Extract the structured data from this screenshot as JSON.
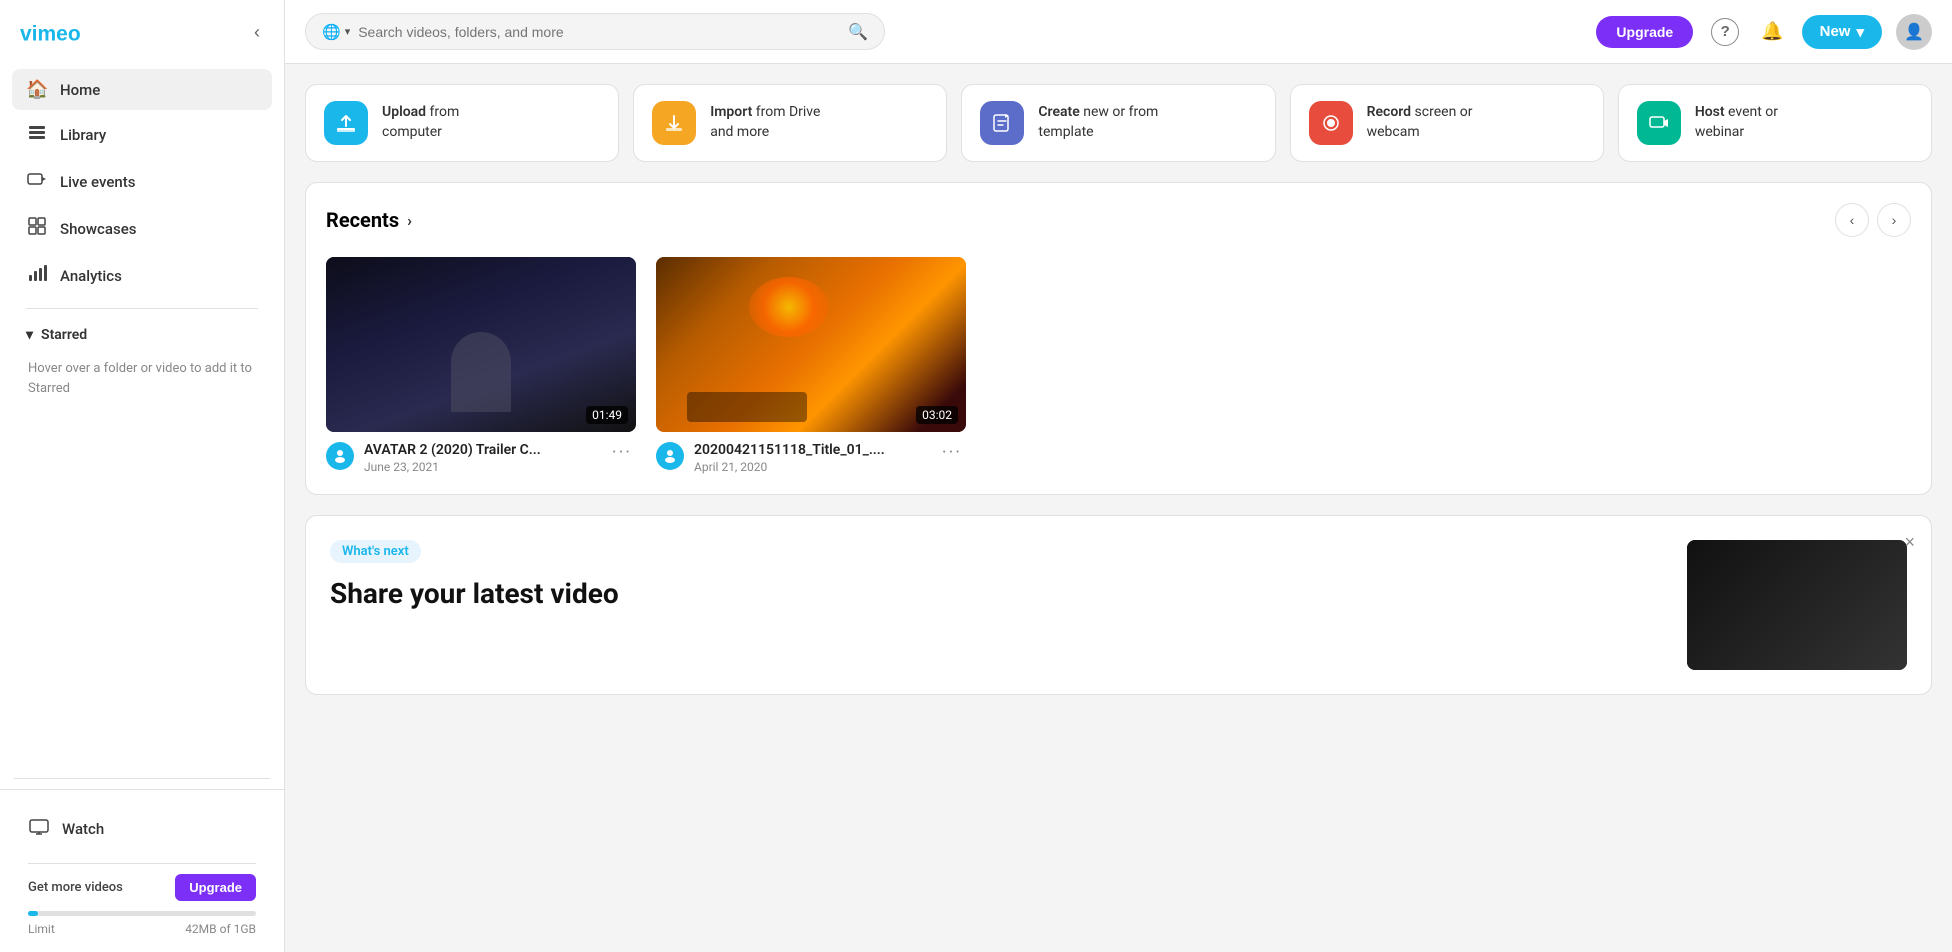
{
  "sidebar": {
    "logo_alt": "Vimeo",
    "collapse_label": "Collapse sidebar",
    "nav_items": [
      {
        "id": "home",
        "label": "Home",
        "icon": "🏠",
        "active": true
      },
      {
        "id": "library",
        "label": "Library",
        "icon": "📁",
        "active": false
      },
      {
        "id": "live-events",
        "label": "Live events",
        "icon": "📹",
        "active": false
      },
      {
        "id": "showcases",
        "label": "Showcases",
        "icon": "⊞",
        "active": false
      },
      {
        "id": "analytics",
        "label": "Analytics",
        "icon": "📊",
        "active": false
      }
    ],
    "starred": {
      "label": "Starred",
      "hint": "Hover over a folder or video to add it to Starred"
    },
    "watch": {
      "label": "Watch",
      "icon": "🖥"
    },
    "upgrade": {
      "label": "Get more videos",
      "button_label": "Upgrade",
      "limit_label": "Limit",
      "storage_used": "42MB of 1GB",
      "storage_pct": 4.2
    }
  },
  "topbar": {
    "search_placeholder": "Search videos, folders, and more",
    "globe_icon": "🌐",
    "upgrade_label": "Upgrade",
    "help_icon": "?",
    "bell_icon": "🔔",
    "new_label": "New",
    "new_chevron": "▾",
    "avatar_icon": "👤"
  },
  "quick_actions": [
    {
      "id": "upload",
      "icon": "☁",
      "icon_color": "#1ab7ea",
      "title": "Upload",
      "subtitle": "from computer"
    },
    {
      "id": "import",
      "icon": "⬇",
      "icon_color": "#f5a623",
      "title": "Import",
      "subtitle": "from Drive and more"
    },
    {
      "id": "create",
      "icon": "✏",
      "icon_color": "#5b6dc8",
      "title": "Create",
      "subtitle": "new or from template"
    },
    {
      "id": "record",
      "icon": "⏺",
      "icon_color": "#e74c3c",
      "title": "Record",
      "subtitle": "screen or webcam"
    },
    {
      "id": "host",
      "icon": "📺",
      "icon_color": "#00b894",
      "title": "Host",
      "subtitle": "event or webinar"
    }
  ],
  "recents": {
    "title": "Recents",
    "chevron": "›",
    "videos": [
      {
        "id": "video1",
        "title": "AVATAR 2 (2020) Trailer C...",
        "date": "June 23, 2021",
        "duration": "01:49",
        "thumb_class": "thumb1"
      },
      {
        "id": "video2",
        "title": "20200421151118_Title_01_....",
        "date": "April 21, 2020",
        "duration": "03:02",
        "thumb_class": "thumb2"
      }
    ],
    "prev_label": "‹",
    "next_label": "›"
  },
  "whats_next": {
    "badge": "What's next",
    "title": "Share your latest video",
    "close_label": "×"
  }
}
